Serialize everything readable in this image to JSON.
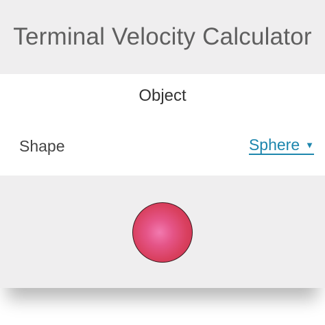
{
  "header": {
    "title": "Terminal Velocity Calculator"
  },
  "section": {
    "title": "Object"
  },
  "shape_field": {
    "label": "Shape",
    "selected": "Sphere",
    "dropdown_icon": "caret-down-icon"
  },
  "illustration": {
    "shape": "sphere",
    "color": "#d9405f"
  },
  "colors": {
    "accent": "#1d86ad",
    "title_text": "#5f5f5f",
    "background": "#efeeef"
  }
}
